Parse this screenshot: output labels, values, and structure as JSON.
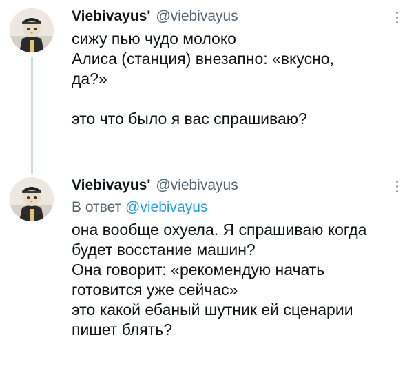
{
  "tweets": [
    {
      "display_name": "Viebivayus'",
      "handle": "@viebivayus",
      "avatar_icon": "cat-avatar-icon",
      "lines": [
        "сижу пью чудо молоко",
        "Алиса (станция) внезапно: «вкусно,",
        "да?»",
        "",
        "это что было я вас спрашиваю?"
      ]
    },
    {
      "display_name": "Viebivayus'",
      "handle": "@viebivayus",
      "avatar_icon": "cat-avatar-icon",
      "reply_prefix": "В ответ",
      "reply_mention": "@viebivayus",
      "lines": [
        "она вообще охуела. Я спрашиваю когда",
        "будет восстание машин?",
        "Она говорит: «рекомендую начать",
        "готовится уже сейчас»",
        "это какой ебаный шутник ей сценарии",
        "пишет блять?"
      ]
    }
  ],
  "colors": {
    "text": "#0f1419",
    "secondary": "#536471",
    "link": "#1d9bf0",
    "thread_line": "#cfd9de"
  }
}
